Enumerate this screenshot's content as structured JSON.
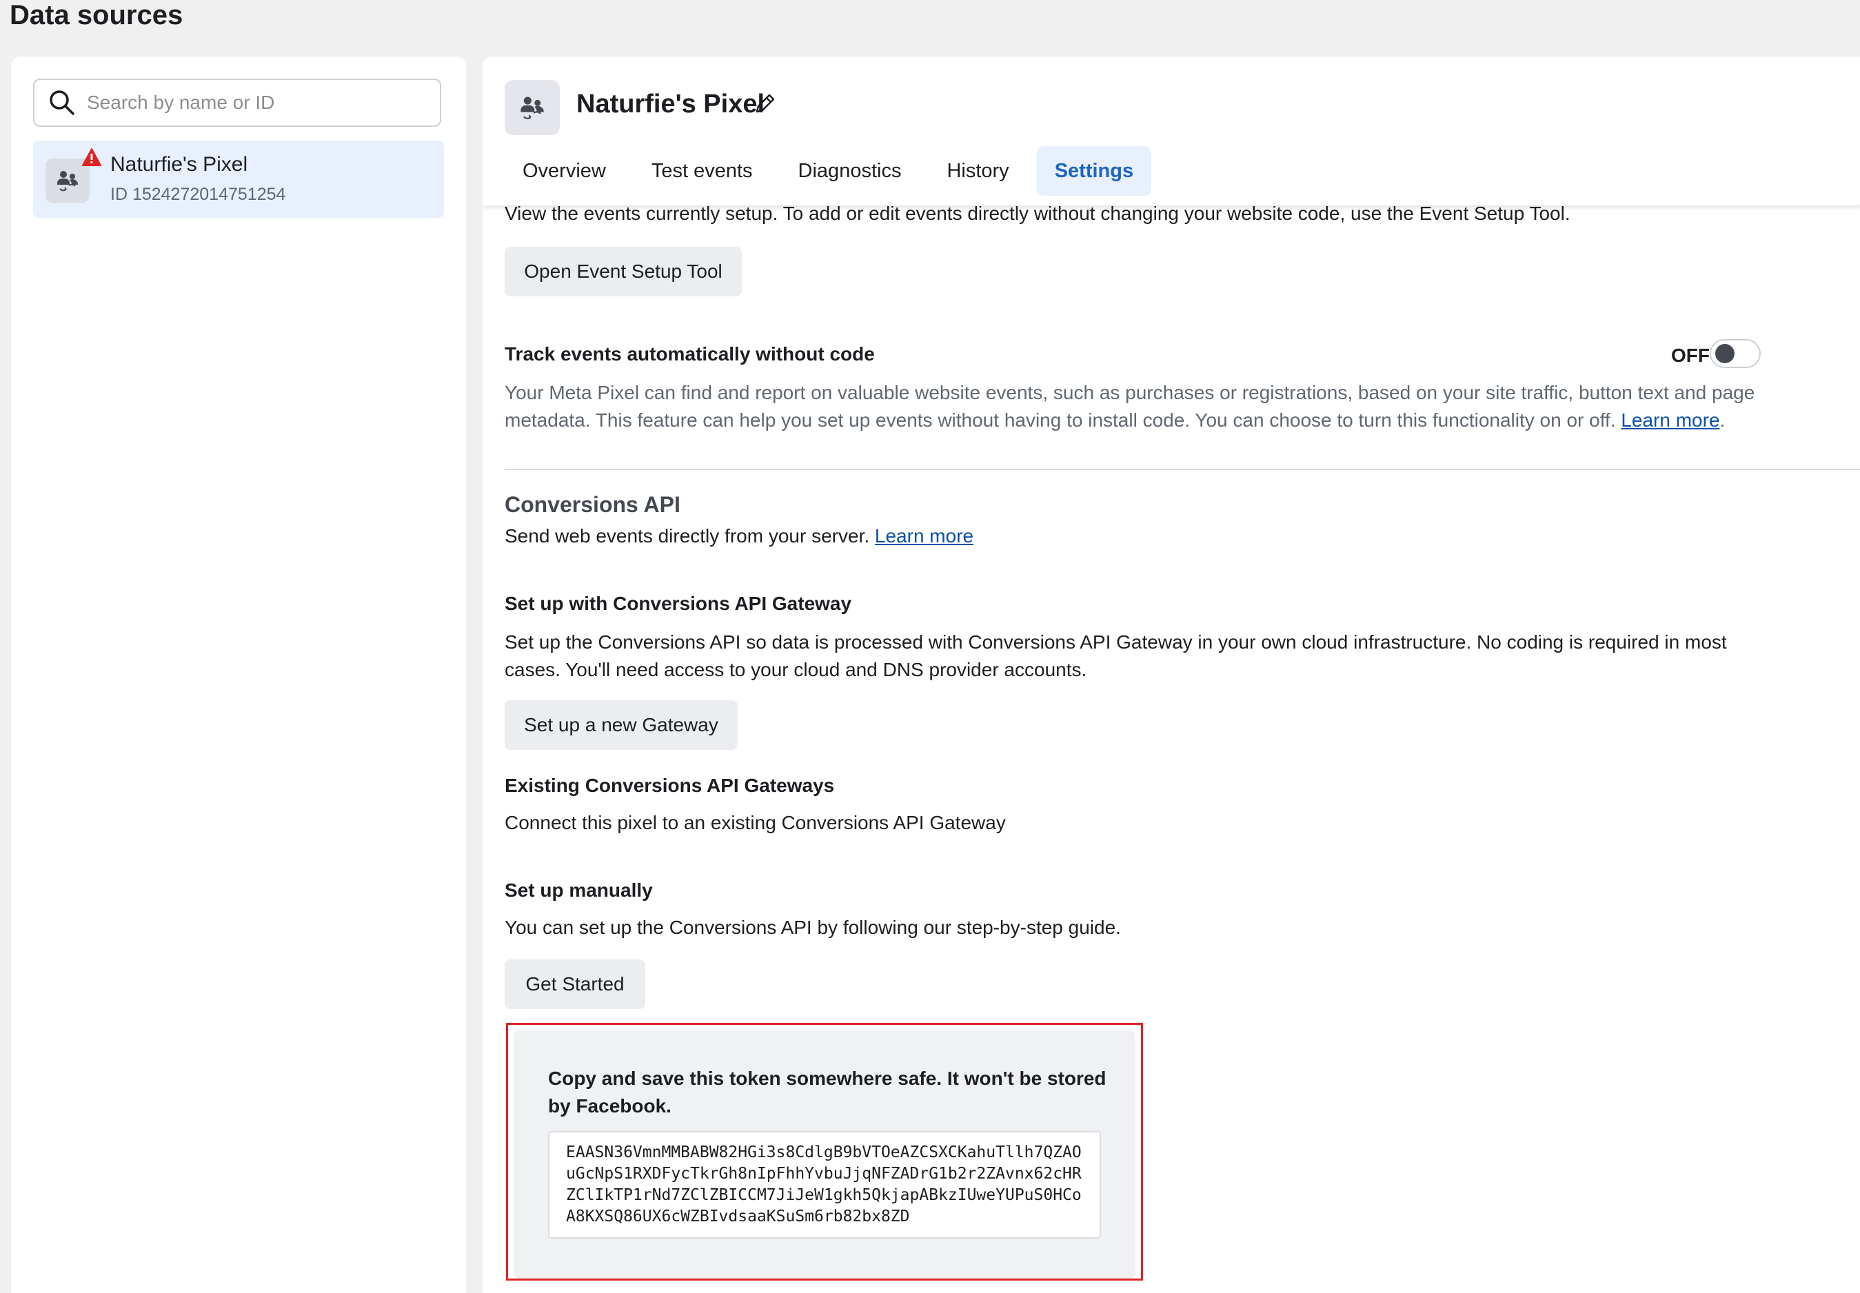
{
  "page": {
    "title": "Data sources"
  },
  "sidebar": {
    "search_placeholder": "Search by name or ID",
    "items": [
      {
        "name": "Naturfie's Pixel",
        "id_text": "ID 1524272014751254",
        "warning": true
      }
    ]
  },
  "header": {
    "pixel_name": "Naturfie's Pixel",
    "tabs": [
      {
        "label": "Overview",
        "active": false
      },
      {
        "label": "Test events",
        "active": false
      },
      {
        "label": "Diagnostics",
        "active": false
      },
      {
        "label": "History",
        "active": false
      },
      {
        "label": "Settings",
        "active": true
      }
    ]
  },
  "event_setup": {
    "description": "View the events currently setup. To add or edit events directly without changing your website code, use the Event Setup Tool.",
    "button": "Open Event Setup Tool"
  },
  "auto_track": {
    "heading": "Track events automatically without code",
    "toggle_label": "OFF",
    "toggle_on": false,
    "description": "Your Meta Pixel can find and report on valuable website events, such as purchases or registrations, based on your site traffic, button text and page metadata. This feature can help you set up events without having to install code. You can choose to turn this functionality on or off.",
    "learn_more": "Learn more",
    "period": "."
  },
  "conversions_api": {
    "title": "Conversions API",
    "description": "Send web events directly from your server.",
    "learn_more": "Learn more",
    "gateway": {
      "heading": "Set up with Conversions API Gateway",
      "description": "Set up the Conversions API so data is processed with Conversions API Gateway in your own cloud infrastructure. No coding is required in most cases. You'll need access to your cloud and DNS provider accounts.",
      "button": "Set up a new Gateway"
    },
    "existing": {
      "heading": "Existing Conversions API Gateways",
      "description": "Connect this pixel to an existing Conversions API Gateway"
    },
    "manual": {
      "heading": "Set up manually",
      "description": "You can set up the Conversions API by following our step-by-step guide.",
      "button": "Get Started"
    },
    "token": {
      "message": "Copy and save this token somewhere safe. It won't be stored by Facebook.",
      "value": "EAASN36VmnMMBABW82HGi3s8CdlgB9bVTOeAZCSXCKahuTllh7QZAOuGcNpS1RXDFycTkrGh8nIpFhhYvbuJjqNFZADrG1b2r2ZAvnx62cHRZClIkTP1rNd7ZClZBICCM7JiJeW1gkh5QkjapABkzIUweYUPuS0HCoA8KXSQ86UX6cWZBIvdsaaKSuSm6rb82bx8ZD"
    }
  },
  "colors": {
    "accent": "#1d65c1",
    "selected_bg": "#e7f0fc",
    "warning": "#e02424",
    "link": "#0a50a6"
  }
}
